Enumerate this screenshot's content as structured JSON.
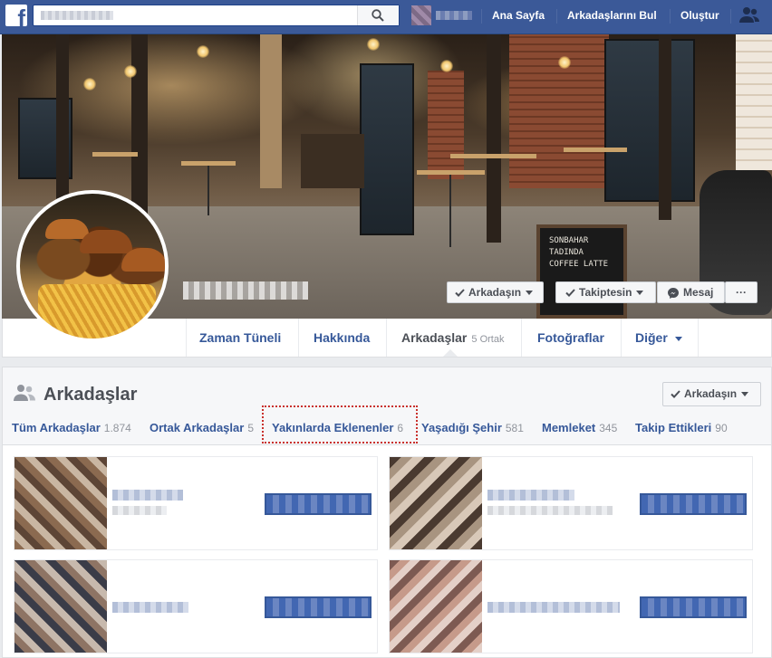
{
  "topbar": {
    "logo": "f",
    "search_value": "",
    "search_placeholder": "",
    "links": [
      "Ana Sayfa",
      "Arkadaşlarını Bul",
      "Oluştur"
    ],
    "brand_color": "#3b5998"
  },
  "cover": {
    "board_lines": [
      "SONBAHAR",
      "TADINDA",
      "COFFEE LATTE"
    ],
    "buttons": {
      "friend": "Arkadaşın",
      "following": "Takiptesin",
      "message": "Mesaj",
      "more": "···"
    }
  },
  "tabs": [
    {
      "label": "Zaman Tüneli",
      "count": ""
    },
    {
      "label": "Hakkında",
      "count": ""
    },
    {
      "label": "Arkadaşlar",
      "count": "5 Ortak"
    },
    {
      "label": "Fotoğraflar",
      "count": ""
    },
    {
      "label": "Diğer",
      "count": ""
    }
  ],
  "friends_panel": {
    "title": "Arkadaşlar",
    "button": "Arkadaşın",
    "subtabs": [
      {
        "label": "Tüm Arkadaşlar",
        "count": "1.874"
      },
      {
        "label": "Ortak Arkadaşlar",
        "count": "5"
      },
      {
        "label": "Yakınlarda Eklenenler",
        "count": "6"
      },
      {
        "label": "Yaşadığı Şehir",
        "count": "581"
      },
      {
        "label": "Memleket",
        "count": "345"
      },
      {
        "label": "Takip Ettikleri",
        "count": "90"
      }
    ],
    "highlighted_subtab": "Yakınlarda Eklenenler"
  }
}
